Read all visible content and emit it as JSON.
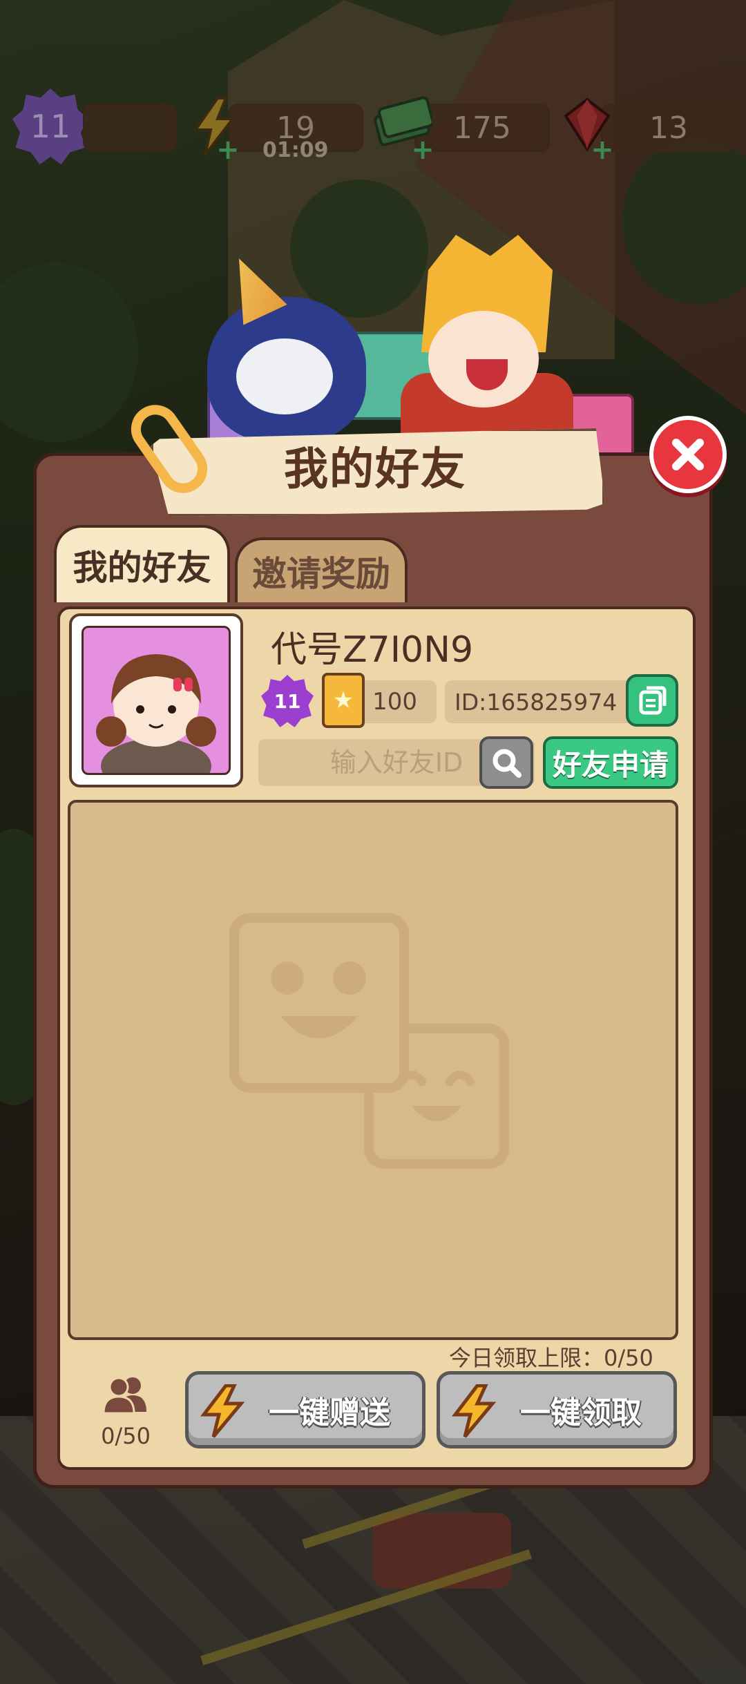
{
  "hud": {
    "level": "11",
    "energy": "19",
    "energy_timer": "01:09",
    "cash": "175",
    "gems": "13"
  },
  "dialog": {
    "title": "我的好友",
    "tabs": [
      {
        "label": "我的好友",
        "active": true
      },
      {
        "label": "邀请奖励",
        "active": false
      }
    ],
    "profile": {
      "name": "代号Z7I0N9",
      "level": "11",
      "stars": "100",
      "id_text": "ID:165825974"
    },
    "search": {
      "placeholder": "输入好友ID",
      "request_label": "好友申请"
    },
    "daily_limit": "今日领取上限：0/50",
    "friend_count": "0/50",
    "buttons": {
      "send_all": "一键赠送",
      "claim_all": "一键领取"
    }
  },
  "colors": {
    "dialog_bg": "#7a4a3e",
    "panel_bg": "#edd6a8",
    "list_bg": "#d8b98c",
    "accent_green": "#3ac983",
    "close_red": "#e8363f",
    "disabled_gray": "#bdbdbd"
  },
  "icons": [
    "energy-icon",
    "cash-icon",
    "gem-icon",
    "close-icon",
    "copy-icon",
    "search-icon",
    "friends-icon",
    "lightning-icon",
    "star-card-icon"
  ]
}
